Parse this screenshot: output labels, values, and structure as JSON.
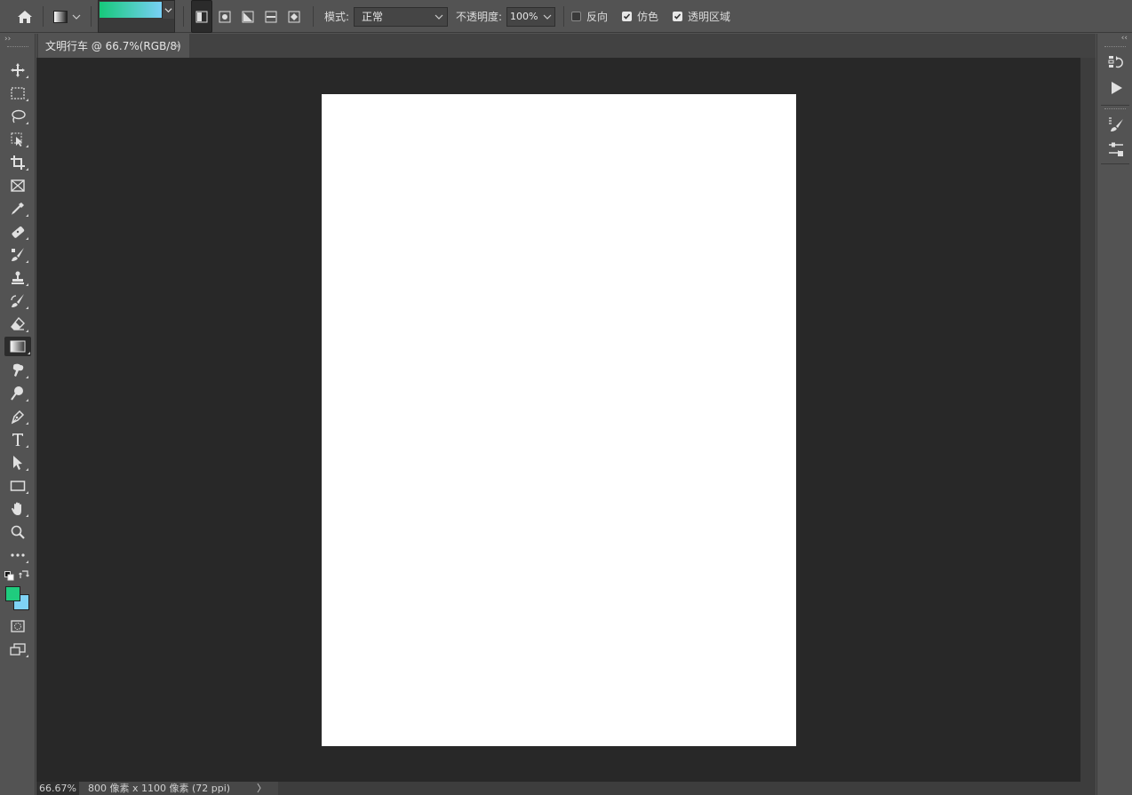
{
  "colors": {
    "foreground": "#1fcc7e",
    "background": "#7fd3f5",
    "gradient_start": "#16c97a",
    "gradient_end": "#7ad0f8"
  },
  "options_bar": {
    "home_icon": "home-icon",
    "mode_label": "模式:",
    "mode_value": "正常",
    "opacity_label": "不透明度:",
    "opacity_value": "100%",
    "reverse_label": "反向",
    "reverse_checked": false,
    "dither_label": "仿色",
    "dither_checked": true,
    "transparency_label": "透明区域",
    "transparency_checked": true,
    "gradient_types": [
      "linear",
      "radial",
      "angle",
      "reflected",
      "diamond"
    ],
    "active_gradient_type": "linear"
  },
  "document": {
    "tab_title": "文明行车 @ 66.7%(RGB/8)",
    "close_glyph": "×"
  },
  "toolbar": {
    "collapse_glyph": "››",
    "tools": [
      "move",
      "marquee",
      "lasso",
      "object-select",
      "crop",
      "frame",
      "eyedropper",
      "healing",
      "brush",
      "stamp",
      "history-brush",
      "eraser",
      "gradient",
      "blur",
      "dodge",
      "pen",
      "type",
      "path-select",
      "rectangle",
      "hand",
      "zoom",
      "more"
    ],
    "active_tool": "gradient"
  },
  "status": {
    "zoom": "66.67%",
    "dimensions": "800 像素 x 1100 像素 (72 ppi)",
    "arrow": "〉"
  },
  "right_panel": {
    "collapse_glyph": "‹‹"
  }
}
